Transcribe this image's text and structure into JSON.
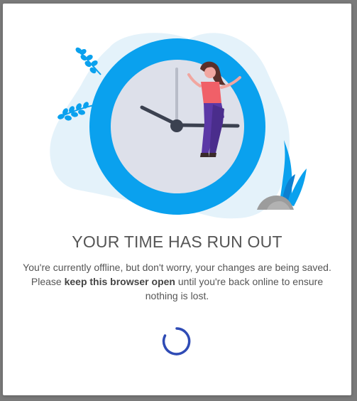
{
  "dialog": {
    "title": "YOUR TIME HAS RUN OUT",
    "message_part1": "You're currently offline, but don't worry, your changes are being saved. Please ",
    "message_bold": "keep this browser open",
    "message_part2": " until you're back online to ensure nothing is lost."
  },
  "illustration": {
    "icon": "clock-with-woman-illustration"
  },
  "spinner": {
    "icon": "loading-spinner-icon",
    "color": "#2f4bb5"
  },
  "colors": {
    "accent_blue": "#0aa1ee",
    "clock_face": "#dde0ea",
    "blob": "#e4f2fa",
    "overlay": "#7a7a7a",
    "text": "#555555"
  }
}
